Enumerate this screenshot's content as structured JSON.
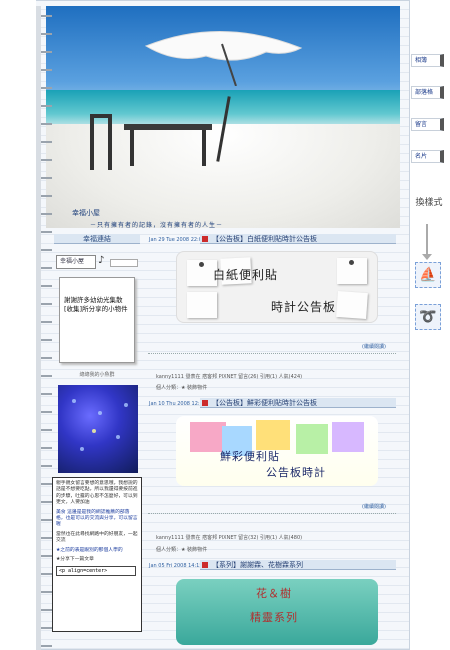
{
  "banner": {
    "title": "幸福小屋",
    "subtitle": "－只有擁有者的記錄，沒有擁有者的人生－"
  },
  "sidebar": {
    "links_heading": "幸福連結",
    "logo_text": "幸福小屋",
    "note_text": "謝謝許多幼幼光集散[收集]所分享的小物件",
    "fish_label": "總總我的小魚群",
    "guestbook": [
      "親手親女留言要想的意思哦，我想說的話是不想要吃點，所以我還得要按前進的步驟，吐露的心思不怎麼好，可以到更文，人要加油",
      "美食 這邊是是我的網誌推薦的部落格，也是可以的交流與分享，可以留言喔",
      "當然也在此尋找網路中的好朋友，一起交流",
      "★之前的表是跟別的那個人學的",
      "★分享下一篇文章"
    ],
    "guestbook_input": "<p align=center>"
  },
  "posts": [
    {
      "meta": "Jan 29 Tue 2008 22:07",
      "title": "【公告板】白紙便利貼時計公告板",
      "image_text": [
        "白紙便利貼",
        "時計公告板"
      ],
      "more": "(繼續閱讀)",
      "footer": "kanny1111 發表在 痞客邦 PIXNET 留言(26) 引用(1) 人氣(424)",
      "category": "個人分類：★ 裝飾物件"
    },
    {
      "meta": "Jan 10 Thu 2008 12:03",
      "title": "【公告板】鮮彩便利貼時計公告板",
      "image_text": [
        "鮮彩便利貼",
        "公告板時計"
      ],
      "more": "(繼續閱讀)",
      "footer": "kanny1111 發表在 痞客邦 PIXNET 留言(32) 引用(1) 人氣(480)",
      "category": "個人分類：★ 裝飾物件"
    },
    {
      "meta": "Jan 05 Fri 2008 14:15",
      "title": "【系列】謝謝霖、花樹霖系列",
      "image_text": [
        "花＆樹",
        "精靈系列"
      ]
    }
  ],
  "right_tabs": [
    "相簿",
    "部落格",
    "留言",
    "名片"
  ],
  "style_label": "換樣式",
  "icons": {
    "style_icon_1": "sailboat-icon",
    "style_icon_2": "swirl-icon"
  },
  "colors": {
    "accent": "#2e5fa0",
    "title_bar": "#dbe6f2",
    "heading_text": "#243f72"
  }
}
